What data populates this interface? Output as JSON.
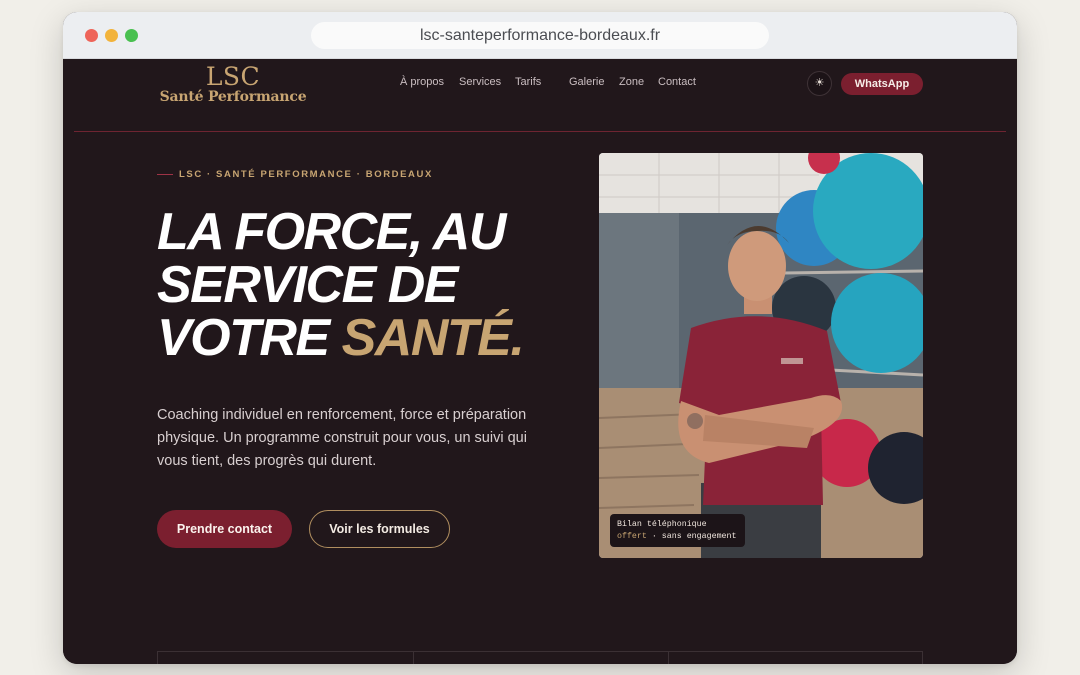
{
  "browser": {
    "url": "lsc-santeperformance-bordeaux.fr"
  },
  "header": {
    "logo": {
      "main": "LSC",
      "sub": "Santé Performance"
    },
    "nav": [
      {
        "label": "À propos"
      },
      {
        "label": "Services"
      },
      {
        "label": "Tarifs"
      },
      {
        "label": "Galerie"
      },
      {
        "label": "Zone"
      },
      {
        "label": "Contact"
      }
    ],
    "theme_toggle_icon": "sun-icon",
    "whatsapp_label": "WhatsApp"
  },
  "hero": {
    "eyebrow": "LSC · SANTÉ PERFORMANCE · BORDEAUX",
    "headline": {
      "line1": "LA FORCE, AU",
      "line2": "SERVICE DE",
      "line3_plain": "VOTRE",
      "line3_accent": "SANTÉ."
    },
    "intro": "Coaching individuel en renforcement, force et préparation physique. Un programme construit pour vous, un suivi qui vous tient, des progrès qui durent.",
    "cta_primary": "Prendre contact",
    "cta_secondary": "Voir les formules",
    "photo_badge": {
      "line1": "Bilan téléphonique",
      "accent": "offert",
      "rest": " · sans engagement"
    }
  },
  "colors": {
    "background": "#21171b",
    "accent_burgundy": "#7b1f2f",
    "accent_gold": "#c8a572"
  }
}
